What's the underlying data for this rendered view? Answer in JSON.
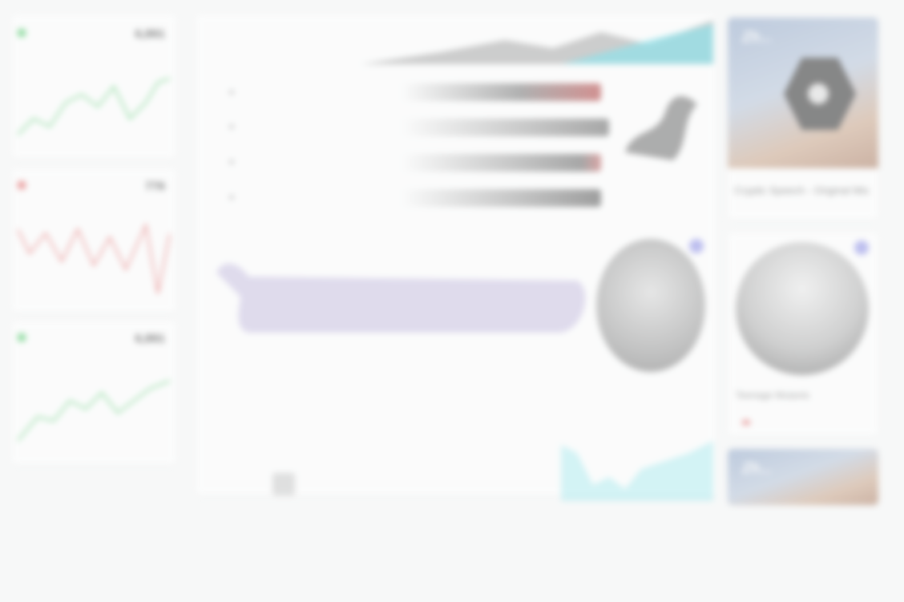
{
  "stats": [
    {
      "value": "6,891",
      "caption": "",
      "color": "#3cc45a",
      "trend": [
        30,
        25,
        40,
        18,
        10,
        22,
        38,
        30,
        12,
        8,
        20,
        35,
        5
      ]
    },
    {
      "value": "776",
      "caption": "",
      "color": "#e05555",
      "trend": [
        10,
        35,
        15,
        40,
        8,
        30,
        12,
        42,
        20,
        5,
        38,
        15,
        45
      ]
    },
    {
      "value": "6,891",
      "caption": "",
      "color": "#3cc45a",
      "trend": [
        40,
        30,
        36,
        18,
        20,
        28,
        14,
        22,
        32,
        10,
        18,
        8,
        4
      ]
    }
  ],
  "footer_left": {
    "left": "",
    "right": ""
  },
  "album": {
    "logo": "Zh...",
    "title": "Cryptic Speech - Original Mix"
  },
  "artist": {
    "name": "Teenage Mutants",
    "tags": [
      "",
      ""
    ],
    "badge_color": "#8e90e8"
  },
  "accent": "#8e90e8"
}
